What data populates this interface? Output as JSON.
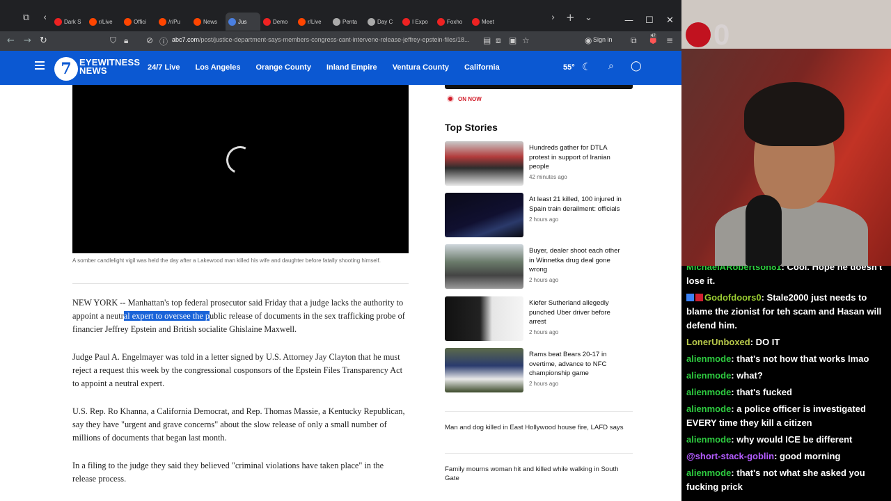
{
  "browser": {
    "tabs": [
      {
        "label": "Dark S",
        "color": "#e22"
      },
      {
        "label": "r/Live",
        "color": "#ff4500"
      },
      {
        "label": "Offici",
        "color": "#ff4500"
      },
      {
        "label": "/r/Pu",
        "color": "#ff4500"
      },
      {
        "label": "News",
        "color": "#ff4500"
      },
      {
        "label": "Jus",
        "color": "#4a7fe0",
        "active": true
      },
      {
        "label": "Demo",
        "color": "#e22"
      },
      {
        "label": "r/Live",
        "color": "#ff4500"
      },
      {
        "label": "Penta",
        "color": "#aaa"
      },
      {
        "label": "Day C",
        "color": "#aaa"
      },
      {
        "label": "I Expo",
        "color": "#e22"
      },
      {
        "label": "Foxho",
        "color": "#e22"
      },
      {
        "label": "Meet",
        "color": "#e22"
      }
    ],
    "url_host": "abc7.com",
    "url_path": "/post/justice-department-says-members-congress-cant-intervene-release-jeffrey-epstein-files/18...",
    "signin_label": "Sign in",
    "extension_badge": "47"
  },
  "site": {
    "logo_number": "7",
    "logo_line1": "EYEWITNESS",
    "logo_line2": "NEWS",
    "nav": [
      "24/7 Live",
      "Los Angeles",
      "Orange County",
      "Inland Empire",
      "Ventura County",
      "California"
    ],
    "temperature": "55°"
  },
  "article": {
    "caption": "A somber candlelight vigil was held the day after a Lakewood man killed his wife and daughter before fatally shooting himself.",
    "p1_a": "NEW YORK -- Manhattan's top federal prosecutor said Friday that a judge lacks the authority to appoint a neutr",
    "p1_hl": "al expert to oversee the p",
    "p1_b": "ublic release of documents in the sex trafficking probe of financier Jeffrey Epstein and British socialite Ghislaine Maxwell.",
    "p2": "Judge Paul A. Engelmayer was told in a letter signed by U.S. Attorney Jay Clayton that he must reject a request this week by the congressional cosponsors of the Epstein Files Transparency Act to appoint a neutral expert.",
    "p3": "U.S. Rep. Ro Khanna, a California Democrat, and Rep. Thomas Massie, a Kentucky Republican, say they have \"urgent and grave concerns\" about the slow release of only a small number of millions of documents that began last month.",
    "p4": "In a filing to the judge they said they believed \"criminal violations have taken place\" in the release process."
  },
  "rail": {
    "on_now": "ON NOW",
    "heading": "Top Stories",
    "stories": [
      {
        "title": "Hundreds gather for DTLA protest in support of Iranian people",
        "time": "42 minutes ago"
      },
      {
        "title": "At least 21 killed, 100 injured in Spain train derailment: officials",
        "time": "2 hours ago"
      },
      {
        "title": "Buyer, dealer shoot each other in Winnetka drug deal gone wrong",
        "time": "2 hours ago"
      },
      {
        "title": "Kiefer Sutherland allegedly punched Uber driver before arrest",
        "time": "2 hours ago"
      },
      {
        "title": "Rams beat Bears 20-17 in overtime, advance to NFC championship game",
        "time": "2 hours ago"
      }
    ],
    "more": [
      "Man and dog killed in East Hollywood house fire, LAFD says",
      "Family mourns woman hit and killed while walking in South Gate"
    ]
  },
  "stream": {
    "counter": "0",
    "chat": [
      {
        "user": "MichaelARobertson81",
        "color": "#2ecc40",
        "text": ": Cool. Hope he doesn't lose it."
      },
      {
        "user": "Godofdoors0",
        "color": "#9acd32",
        "text": ": Stale2000 just needs to blame the zionist for teh scam and Hasan will defend him."
      },
      {
        "user": "LonerUnboxed",
        "color": "#b8c94a",
        "text": ": DO IT"
      },
      {
        "user": "alienmode",
        "color": "#2ecc40",
        "text": ": that's not how that works lmao"
      },
      {
        "user": "alienmode",
        "color": "#2ecc40",
        "text": ": what?"
      },
      {
        "user": "alienmode",
        "color": "#2ecc40",
        "text": ": that's fucked"
      },
      {
        "user": "alienmode",
        "color": "#2ecc40",
        "text": ": a police officer is investigated EVERY time they kill a citizen"
      },
      {
        "user": "alienmode",
        "color": "#2ecc40",
        "text": ": why would ICE be different"
      },
      {
        "user": "@short-stack-goblin",
        "color": "#b45cff",
        "text": ": good morning"
      },
      {
        "user": "alienmode",
        "color": "#2ecc40",
        "text": ": that's not what she asked you fucking prick"
      }
    ]
  }
}
